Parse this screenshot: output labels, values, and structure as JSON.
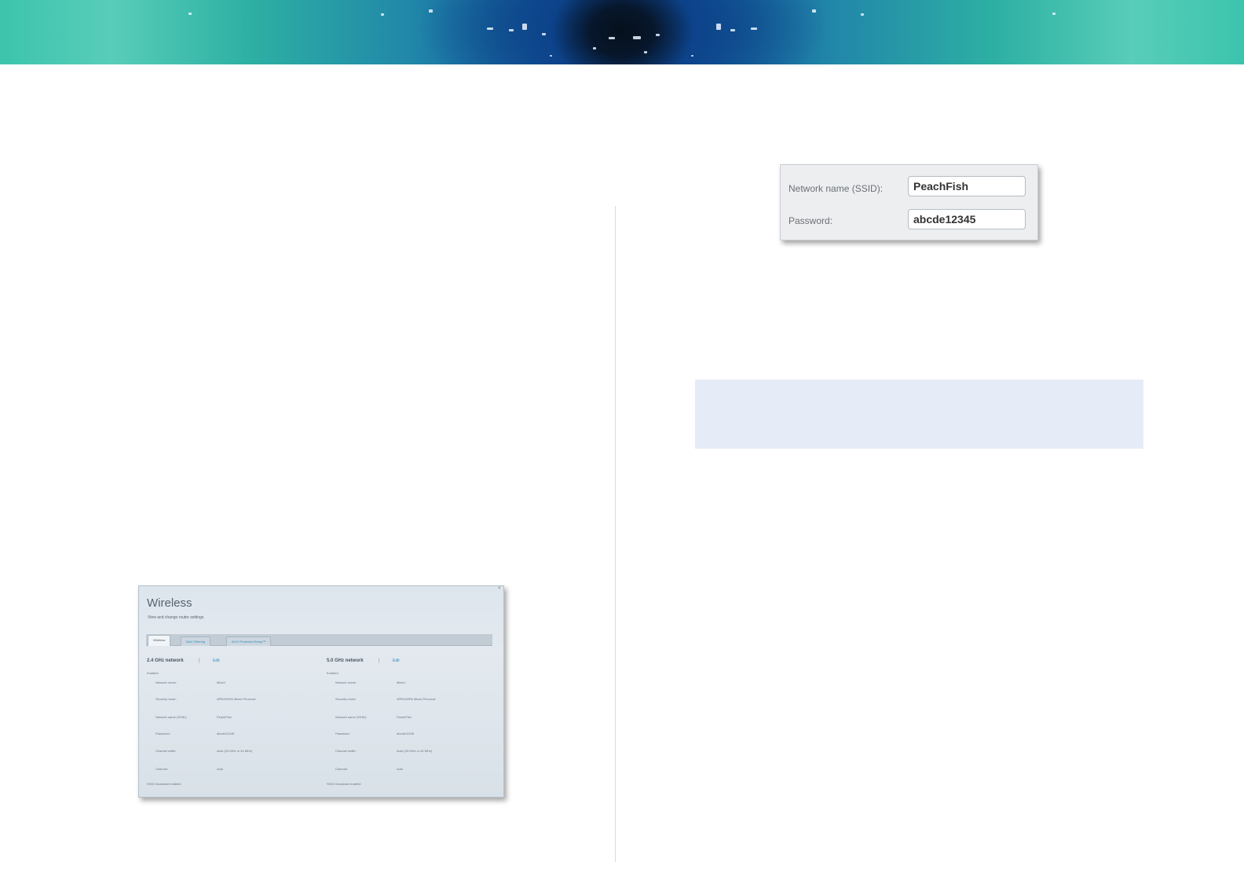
{
  "figure_panel": {
    "close_glyph": "×",
    "title": "Wireless",
    "subtitle": "View and change router settings",
    "tabs": [
      {
        "label": "Wireless"
      },
      {
        "label": "MAC Filtering"
      },
      {
        "label": "Wi-Fi Protected Setup™"
      }
    ],
    "columns": [
      {
        "heading": "2.4 GHz network",
        "separator": "|",
        "edit_label": "Edit",
        "status": "Enabled",
        "rows": [
          {
            "label": "Network mode:",
            "value": "Mixed"
          },
          {
            "label": "Security mode:",
            "value": "WPA2/WPA Mixed Personal"
          },
          {
            "label": "Network name (SSID):",
            "value": "PeachFish"
          },
          {
            "label": "Password:",
            "value": "abcde12345"
          },
          {
            "label": "Channel width:",
            "value": "Auto (20 MHz or 40 MHz)"
          },
          {
            "label": "Channel:",
            "value": "Auto"
          }
        ],
        "footer": "SSID broadcast enabled"
      },
      {
        "heading": "5.0 GHz network",
        "separator": "|",
        "edit_label": "Edit",
        "status": "Enabled",
        "rows": [
          {
            "label": "Network mode:",
            "value": "Mixed"
          },
          {
            "label": "Security mode:",
            "value": "WPA2/WPA Mixed Personal"
          },
          {
            "label": "Network name (SSID):",
            "value": "PeachFish"
          },
          {
            "label": "Password:",
            "value": "abcde12345"
          },
          {
            "label": "Channel width:",
            "value": "Auto (20 MHz or 40 MHz)"
          },
          {
            "label": "Channel:",
            "value": "Auto"
          }
        ],
        "footer": "SSID broadcast enabled"
      }
    ]
  },
  "credentials_snippet": {
    "ssid_label": "Network name (SSID):",
    "ssid_value": "PeachFish",
    "password_label": "Password:",
    "password_value": "abcde12345"
  }
}
